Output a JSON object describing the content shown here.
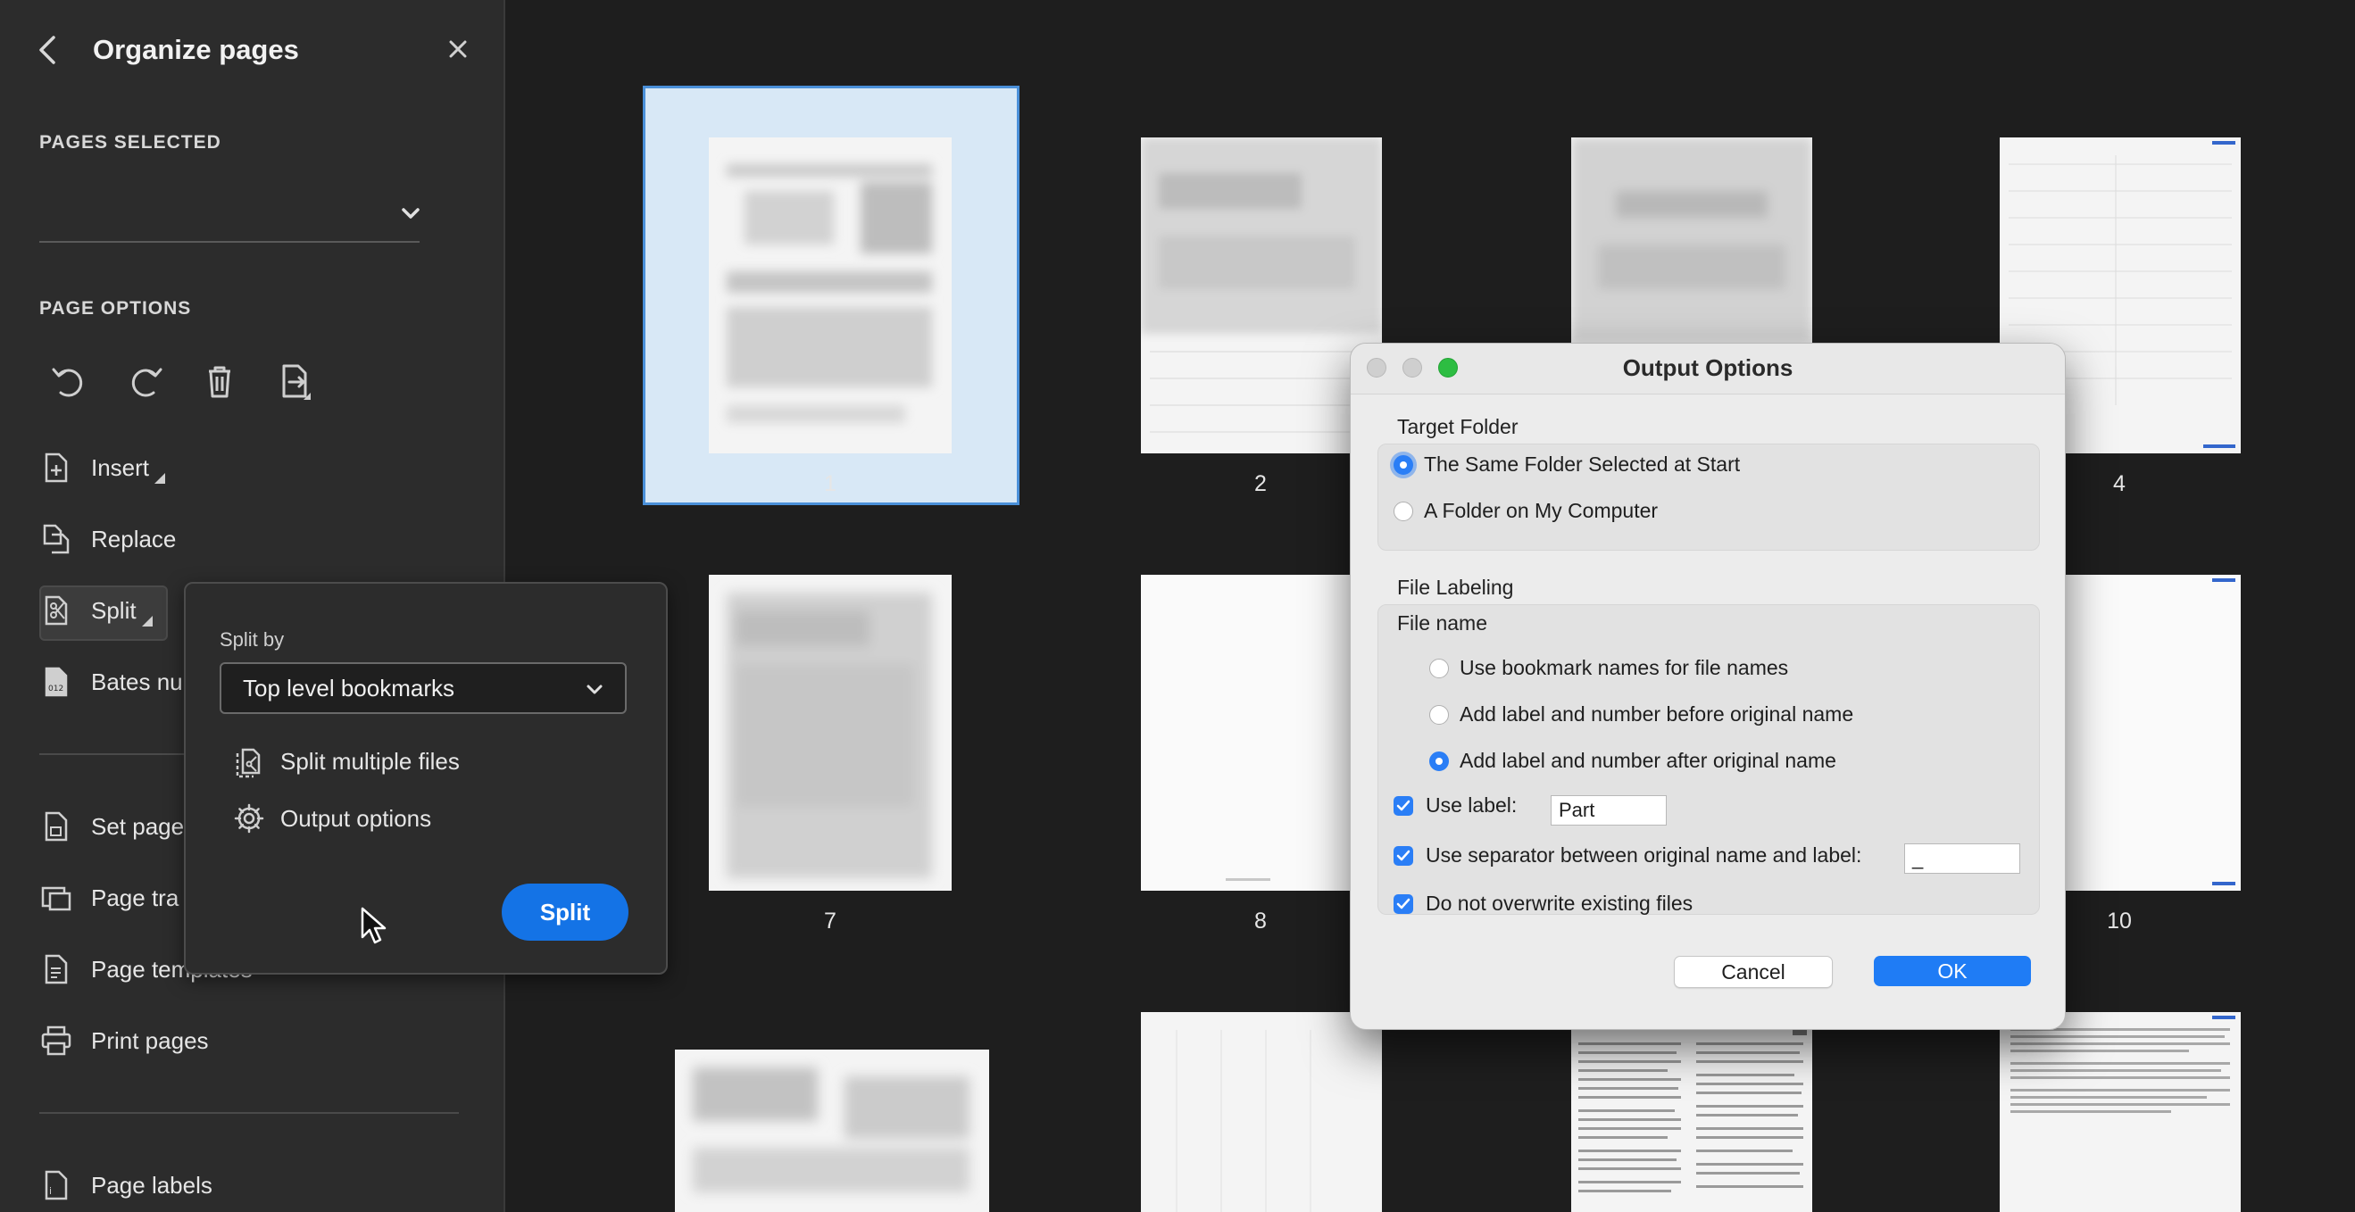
{
  "sidebar": {
    "title": "Organize pages",
    "pages_selected_label": "PAGES SELECTED",
    "page_options_label": "PAGE OPTIONS",
    "items": [
      {
        "label": "Insert",
        "icon": "insert-page-icon"
      },
      {
        "label": "Replace",
        "icon": "replace-page-icon"
      },
      {
        "label": "Split",
        "icon": "split-page-icon"
      },
      {
        "label": "Bates nu",
        "icon": "bates-number-icon"
      },
      {
        "label": "Set page",
        "icon": "set-page-icon"
      },
      {
        "label": "Page tra",
        "icon": "page-transitions-icon"
      },
      {
        "label": "Page templates",
        "icon": "page-templates-icon"
      },
      {
        "label": "Print pages",
        "icon": "print-icon"
      },
      {
        "label": "Page labels",
        "icon": "page-labels-icon"
      }
    ]
  },
  "split_popover": {
    "split_by_label": "Split by",
    "selected_option": "Top level bookmarks",
    "split_multiple_files": "Split multiple files",
    "output_options": "Output options",
    "split_button": "Split"
  },
  "thumbnails": [
    "1",
    "2",
    "4",
    "7",
    "8",
    "10"
  ],
  "dialog": {
    "title": "Output Options",
    "target_folder_label": "Target Folder",
    "target_options": [
      "The Same Folder Selected at Start",
      "A Folder on My Computer"
    ],
    "target_selected": 0,
    "file_labeling_label": "File Labeling",
    "file_name_label": "File name",
    "name_options": [
      "Use bookmark names for file names",
      "Add label and number before original name",
      "Add label and number after original name"
    ],
    "name_selected": 2,
    "use_label_text": "Use label:",
    "label_value": "Part",
    "use_separator_text": "Use separator between original name and label:",
    "separator_value": "_",
    "overwrite_text": "Do not overwrite existing files",
    "cancel_label": "Cancel",
    "ok_label": "OK"
  },
  "colors": {
    "accent": "#1473e6",
    "mac_blue": "#2a7ef6",
    "traffic_close": "#c9c9c9",
    "traffic_max": "#2dbd42"
  }
}
